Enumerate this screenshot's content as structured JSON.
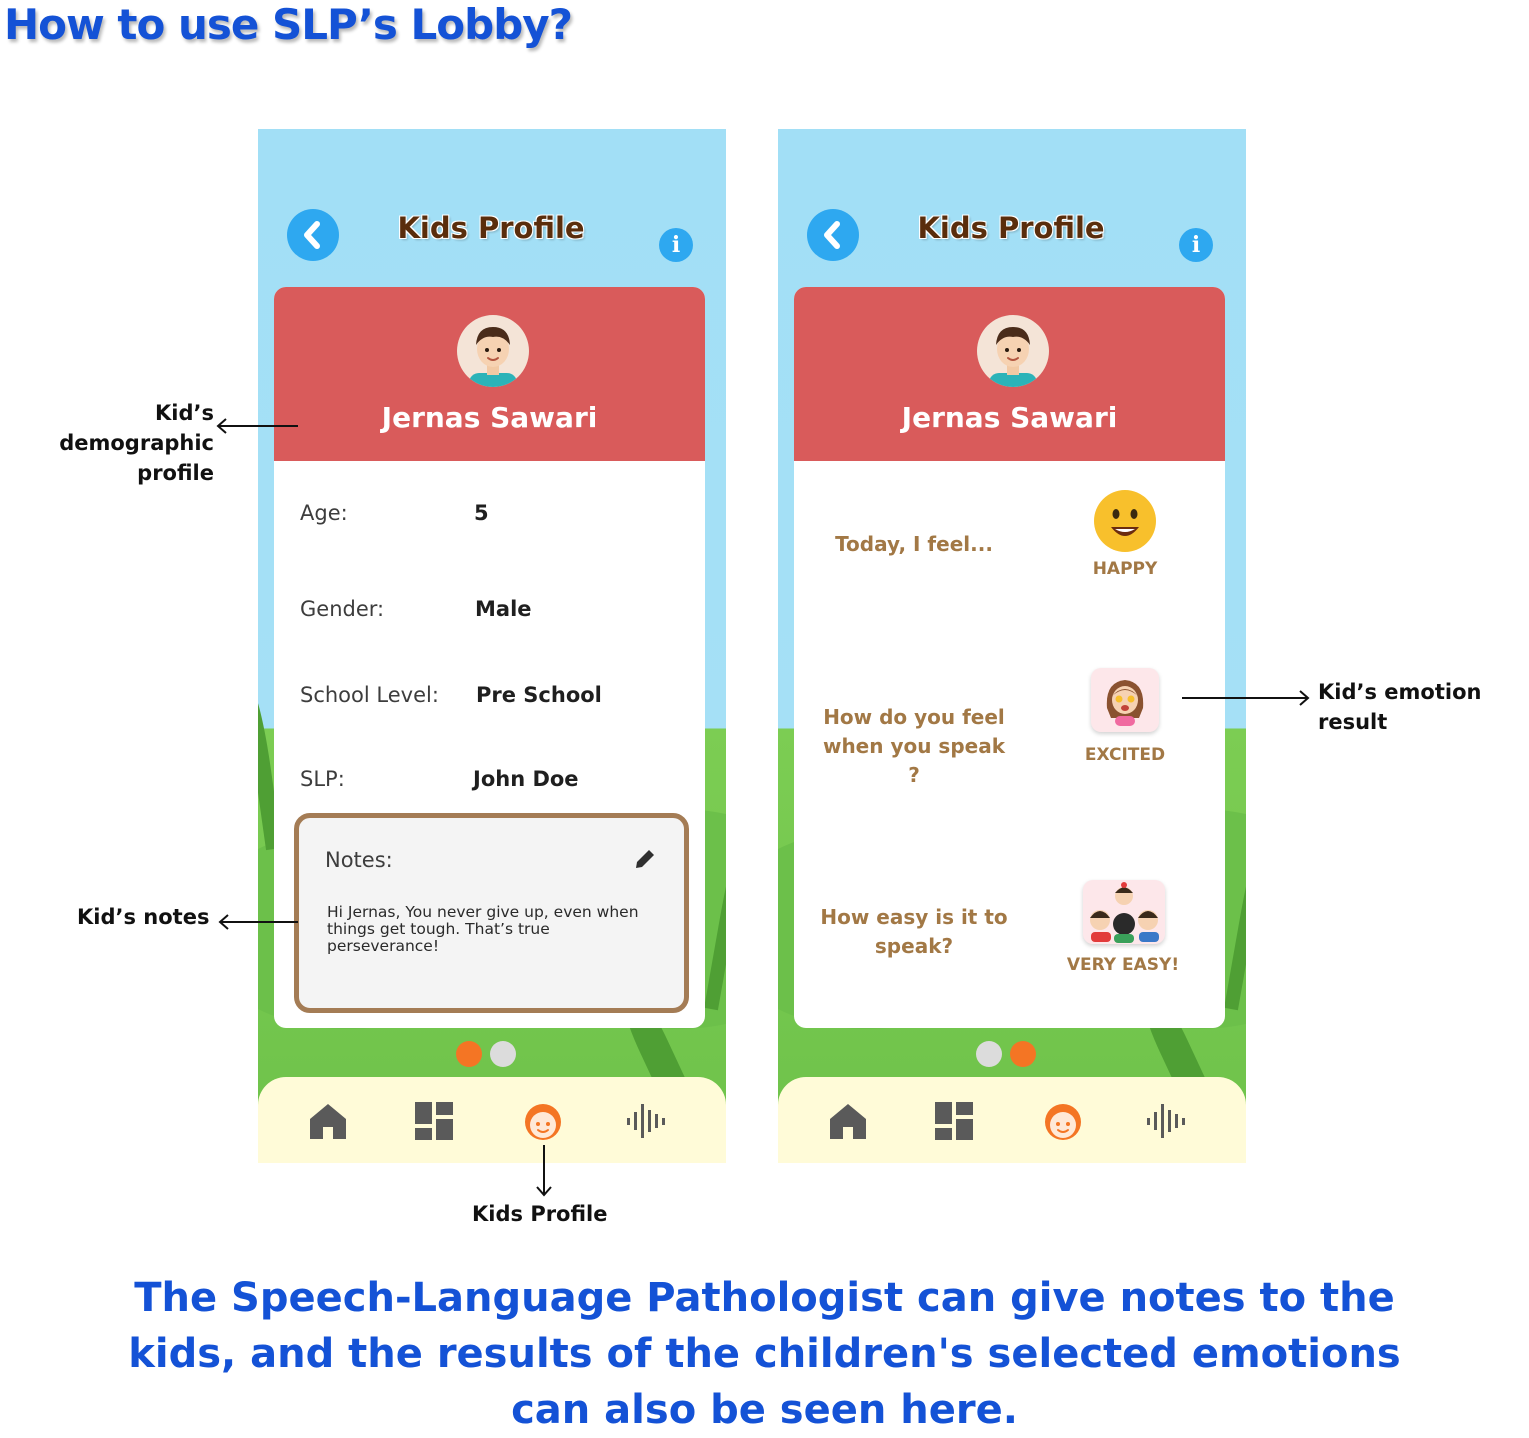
{
  "page_title": "How to use SLP’s Lobby?",
  "colors": {
    "title_blue": "#1452d6",
    "header_red": "#d95b5b",
    "accent_orange": "#f47524",
    "sky_blue": "#a2dff6",
    "grass_green": "#6ec24a",
    "nav_cream": "#fffbd8",
    "text_tan": "#a27845",
    "notes_border": "#a47c55",
    "button_blue": "#2ea8f0"
  },
  "phone1": {
    "header": {
      "title": "Kids Profile",
      "back_icon": "chevron-left-icon",
      "info_icon": "info-icon",
      "info_glyph": "i"
    },
    "kid_name": "Jernas Sawari",
    "fields": [
      {
        "label": "Age:",
        "value": "5"
      },
      {
        "label": "Gender:",
        "value": "Male"
      },
      {
        "label": "School Level:",
        "value": "Pre School"
      },
      {
        "label": "SLP:",
        "value": "John Doe"
      }
    ],
    "notes": {
      "label": "Notes:",
      "text": "Hi Jernas, You never give up, even when things get tough. That’s true perseverance!",
      "edit_icon": "pencil-icon"
    },
    "pager": {
      "total": 2,
      "active": 1
    }
  },
  "phone2": {
    "header": {
      "title": "Kids Profile",
      "back_icon": "chevron-left-icon",
      "info_icon": "info-icon",
      "info_glyph": "i"
    },
    "kid_name": "Jernas Sawari",
    "emotions": [
      {
        "question": "Today, I feel...",
        "result": "HAPPY",
        "icon": "happy-face-icon"
      },
      {
        "question": "How do you feel when you speak ?",
        "result": "EXCITED",
        "icon": "excited-girl-icon"
      },
      {
        "question": "How easy is it to speak?",
        "result": "VERY EASY!",
        "icon": "kids-group-icon"
      }
    ],
    "pager": {
      "total": 2,
      "active": 2
    }
  },
  "nav_items": [
    {
      "icon": "home-icon",
      "active": false
    },
    {
      "icon": "dashboard-icon",
      "active": false
    },
    {
      "icon": "kid-face-icon",
      "active": true
    },
    {
      "icon": "audio-wave-icon",
      "active": false
    }
  ],
  "annotations": {
    "demographic": "Kid’s demographic profile",
    "demographic_line1": "Kid’s demographic",
    "demographic_line2": "profile",
    "notes": "Kid’s notes",
    "kids_profile": "Kids Profile",
    "emotion": "Kid’s emotion result",
    "emotion_line1": "Kid’s emotion",
    "emotion_line2": "result"
  },
  "caption": {
    "line1": "The Speech-Language Pathologist can give notes to the",
    "line2": "kids, and the results of the children's selected emotions",
    "line3": "can also be seen here."
  }
}
